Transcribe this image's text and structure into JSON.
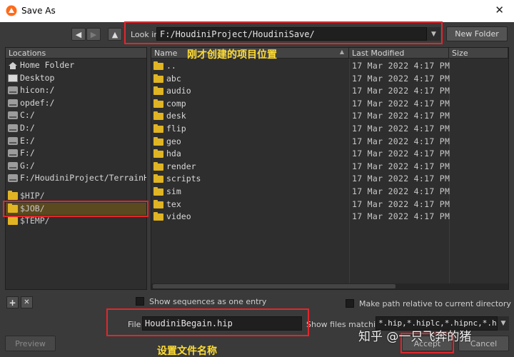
{
  "window": {
    "title": "Save As",
    "close_glyph": "✕",
    "icon": "houdini-logo-icon"
  },
  "toolbar": {
    "back_glyph": "◀",
    "forward_glyph": "▶",
    "up_glyph": "▲",
    "lookin_label": "Look in",
    "lookin_value": "F:/HoudiniProject/HoudiniSave/",
    "new_folder_label": "New Folder"
  },
  "locations": {
    "header": "Locations",
    "items": [
      {
        "label": "Home Folder",
        "icon": "home-icon"
      },
      {
        "label": "Desktop",
        "icon": "desktop-icon"
      },
      {
        "label": "hicon:/",
        "icon": "drive-icon"
      },
      {
        "label": "opdef:/",
        "icon": "drive-icon"
      },
      {
        "label": "C:/",
        "icon": "drive-icon"
      },
      {
        "label": "D:/",
        "icon": "drive-icon"
      },
      {
        "label": "E:/",
        "icon": "drive-icon"
      },
      {
        "label": "F:/",
        "icon": "drive-icon"
      },
      {
        "label": "G:/",
        "icon": "drive-icon"
      },
      {
        "label": "F:/HoudiniProject/TerrainH",
        "icon": "drive-icon"
      }
    ],
    "var_items": [
      {
        "label": "$HIP/",
        "icon": "folder-icon"
      },
      {
        "label": "$JOB/",
        "icon": "folder-icon",
        "selected": true
      },
      {
        "label": "$TEMP/",
        "icon": "folder-icon"
      }
    ]
  },
  "filelist": {
    "columns": {
      "name": "Name",
      "sort_glyph": "▲",
      "modified": "Last Modified",
      "size": "Size"
    },
    "date": "17 Mar 2022   4:17 PM",
    "rows": [
      "..",
      "abc",
      "audio",
      "comp",
      "desk",
      "flip",
      "geo",
      "hda",
      "render",
      "scripts",
      "sim",
      "tex",
      "video"
    ]
  },
  "annotations": {
    "lookin_note": "刚才创建的项目位置",
    "file_note": "设置文件名称"
  },
  "bottom": {
    "add_glyph": "+",
    "remove_glyph": "✕",
    "show_sequences_label": "Show sequences as one entry",
    "relative_path_label": "Make path relative to current directory",
    "file_label": "File",
    "file_value": "HoudiniBegain.hip",
    "match_label": "Show files matching",
    "match_value": "*.hip,*.hiplc,*.hipnc,*.h",
    "preview_label": "Preview",
    "accept_label": "Accept",
    "cancel_label": "Cancel",
    "drop_glyph": "▼"
  },
  "watermark": "知乎 @一只飞奔的猪",
  "colors": {
    "folder": "#e0b423",
    "selection": "#5b4a1f",
    "highlight_box": "#e2262c",
    "note_text": "#ffdd33"
  }
}
